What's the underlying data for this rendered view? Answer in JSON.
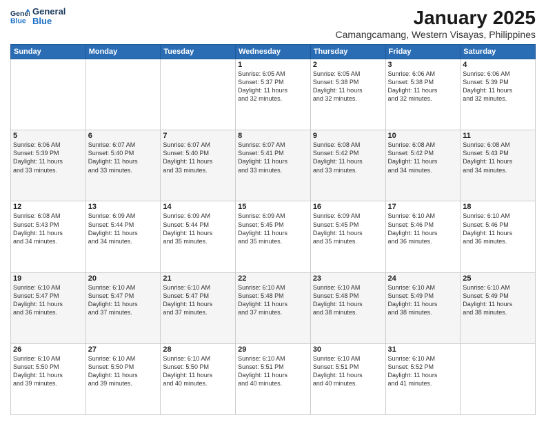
{
  "header": {
    "logo_line1": "General",
    "logo_line2": "Blue",
    "month": "January 2025",
    "location": "Camangcamang, Western Visayas, Philippines"
  },
  "weekdays": [
    "Sunday",
    "Monday",
    "Tuesday",
    "Wednesday",
    "Thursday",
    "Friday",
    "Saturday"
  ],
  "weeks": [
    {
      "row_class": "",
      "days": [
        {
          "num": "",
          "info": ""
        },
        {
          "num": "",
          "info": ""
        },
        {
          "num": "",
          "info": ""
        },
        {
          "num": "1",
          "info": "Sunrise: 6:05 AM\nSunset: 5:37 PM\nDaylight: 11 hours\nand 32 minutes."
        },
        {
          "num": "2",
          "info": "Sunrise: 6:05 AM\nSunset: 5:38 PM\nDaylight: 11 hours\nand 32 minutes."
        },
        {
          "num": "3",
          "info": "Sunrise: 6:06 AM\nSunset: 5:38 PM\nDaylight: 11 hours\nand 32 minutes."
        },
        {
          "num": "4",
          "info": "Sunrise: 6:06 AM\nSunset: 5:39 PM\nDaylight: 11 hours\nand 32 minutes."
        }
      ]
    },
    {
      "row_class": "alt",
      "days": [
        {
          "num": "5",
          "info": "Sunrise: 6:06 AM\nSunset: 5:39 PM\nDaylight: 11 hours\nand 33 minutes."
        },
        {
          "num": "6",
          "info": "Sunrise: 6:07 AM\nSunset: 5:40 PM\nDaylight: 11 hours\nand 33 minutes."
        },
        {
          "num": "7",
          "info": "Sunrise: 6:07 AM\nSunset: 5:40 PM\nDaylight: 11 hours\nand 33 minutes."
        },
        {
          "num": "8",
          "info": "Sunrise: 6:07 AM\nSunset: 5:41 PM\nDaylight: 11 hours\nand 33 minutes."
        },
        {
          "num": "9",
          "info": "Sunrise: 6:08 AM\nSunset: 5:42 PM\nDaylight: 11 hours\nand 33 minutes."
        },
        {
          "num": "10",
          "info": "Sunrise: 6:08 AM\nSunset: 5:42 PM\nDaylight: 11 hours\nand 34 minutes."
        },
        {
          "num": "11",
          "info": "Sunrise: 6:08 AM\nSunset: 5:43 PM\nDaylight: 11 hours\nand 34 minutes."
        }
      ]
    },
    {
      "row_class": "",
      "days": [
        {
          "num": "12",
          "info": "Sunrise: 6:08 AM\nSunset: 5:43 PM\nDaylight: 11 hours\nand 34 minutes."
        },
        {
          "num": "13",
          "info": "Sunrise: 6:09 AM\nSunset: 5:44 PM\nDaylight: 11 hours\nand 34 minutes."
        },
        {
          "num": "14",
          "info": "Sunrise: 6:09 AM\nSunset: 5:44 PM\nDaylight: 11 hours\nand 35 minutes."
        },
        {
          "num": "15",
          "info": "Sunrise: 6:09 AM\nSunset: 5:45 PM\nDaylight: 11 hours\nand 35 minutes."
        },
        {
          "num": "16",
          "info": "Sunrise: 6:09 AM\nSunset: 5:45 PM\nDaylight: 11 hours\nand 35 minutes."
        },
        {
          "num": "17",
          "info": "Sunrise: 6:10 AM\nSunset: 5:46 PM\nDaylight: 11 hours\nand 36 minutes."
        },
        {
          "num": "18",
          "info": "Sunrise: 6:10 AM\nSunset: 5:46 PM\nDaylight: 11 hours\nand 36 minutes."
        }
      ]
    },
    {
      "row_class": "alt",
      "days": [
        {
          "num": "19",
          "info": "Sunrise: 6:10 AM\nSunset: 5:47 PM\nDaylight: 11 hours\nand 36 minutes."
        },
        {
          "num": "20",
          "info": "Sunrise: 6:10 AM\nSunset: 5:47 PM\nDaylight: 11 hours\nand 37 minutes."
        },
        {
          "num": "21",
          "info": "Sunrise: 6:10 AM\nSunset: 5:47 PM\nDaylight: 11 hours\nand 37 minutes."
        },
        {
          "num": "22",
          "info": "Sunrise: 6:10 AM\nSunset: 5:48 PM\nDaylight: 11 hours\nand 37 minutes."
        },
        {
          "num": "23",
          "info": "Sunrise: 6:10 AM\nSunset: 5:48 PM\nDaylight: 11 hours\nand 38 minutes."
        },
        {
          "num": "24",
          "info": "Sunrise: 6:10 AM\nSunset: 5:49 PM\nDaylight: 11 hours\nand 38 minutes."
        },
        {
          "num": "25",
          "info": "Sunrise: 6:10 AM\nSunset: 5:49 PM\nDaylight: 11 hours\nand 38 minutes."
        }
      ]
    },
    {
      "row_class": "",
      "days": [
        {
          "num": "26",
          "info": "Sunrise: 6:10 AM\nSunset: 5:50 PM\nDaylight: 11 hours\nand 39 minutes."
        },
        {
          "num": "27",
          "info": "Sunrise: 6:10 AM\nSunset: 5:50 PM\nDaylight: 11 hours\nand 39 minutes."
        },
        {
          "num": "28",
          "info": "Sunrise: 6:10 AM\nSunset: 5:50 PM\nDaylight: 11 hours\nand 40 minutes."
        },
        {
          "num": "29",
          "info": "Sunrise: 6:10 AM\nSunset: 5:51 PM\nDaylight: 11 hours\nand 40 minutes."
        },
        {
          "num": "30",
          "info": "Sunrise: 6:10 AM\nSunset: 5:51 PM\nDaylight: 11 hours\nand 40 minutes."
        },
        {
          "num": "31",
          "info": "Sunrise: 6:10 AM\nSunset: 5:52 PM\nDaylight: 11 hours\nand 41 minutes."
        },
        {
          "num": "",
          "info": ""
        }
      ]
    }
  ]
}
